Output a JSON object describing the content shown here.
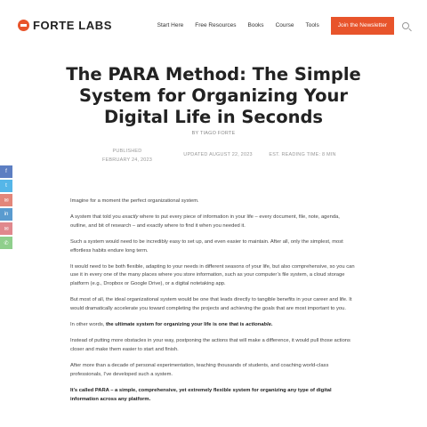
{
  "brand": {
    "name": "FORTE LABS",
    "accent_color": "#e8542b"
  },
  "nav": {
    "items": [
      "Start Here",
      "Free Resources",
      "Books",
      "Course",
      "Tools"
    ],
    "cta_label": "Join the Newsletter",
    "search_icon": "search-icon"
  },
  "article": {
    "title": "The PARA Method: The Simple System for Organizing Your Digital Life in Seconds",
    "byline": "BY TIAGO FORTE",
    "published_label": "PUBLISHED",
    "published_date": "FEBRUARY 24, 2023",
    "updated": "UPDATED AUGUST 22, 2023",
    "reading_time": "EST. READING TIME: 8 MIN",
    "p1": "Imagine for a moment the perfect organizational system.",
    "p2_before": "A system that told you ",
    "p2_em": "exactly",
    "p2_after": " where to put every piece of information in your life – every document, file, note, agenda, outline, and bit of research – and exactly where to find it when you needed it.",
    "p3": "Such a system would need to be incredibly easy to set up, and even easier to maintain. After all, only the simplest, most effortless habits endure long term.",
    "p4": "It would need to be both flexible, adapting to your needs in different seasons of your life, but also comprehensive, so you can use it in every one of the many places where you store information, such as your computer’s file system, a cloud storage platform (e.g., Dropbox or Google Drive), or a digital notetaking app.",
    "p5": "But most of all, the ideal organizational system would be one that leads directly to tangible benefits in your career and life. It would dramatically accelerate you toward completing the projects and achieving the goals that are most important to you.",
    "p6_before": "In other words, ",
    "p6_strong": "the ultimate system for organizing your life is one that is ",
    "p6_strong_em": "actionable",
    "p6_end": ".",
    "p7": "Instead of putting more obstacles in your way, postponing the actions that will make a difference, it would pull those actions closer and make them easier to start and finish.",
    "p8": "After more than a decade of personal experimentation, teaching thousands of students, and coaching world-class professionals, I’ve developed such a system.",
    "p9": "It’s called PARA – a simple, comprehensive, yet extremely flexible system for organizing any type of digital information across any platform."
  },
  "share_buttons": [
    {
      "icon": "facebook-icon",
      "glyph": "f",
      "color": "#5c7ec2"
    },
    {
      "icon": "twitter-icon",
      "glyph": "t",
      "color": "#55b6e8"
    },
    {
      "icon": "email-icon",
      "glyph": "✉",
      "color": "#e3867a"
    },
    {
      "icon": "linkedin-icon",
      "glyph": "in",
      "color": "#5a9bcf"
    },
    {
      "icon": "mail-icon",
      "glyph": "✉",
      "color": "#e0888d"
    },
    {
      "icon": "sms-icon",
      "glyph": "✆",
      "color": "#8fcf8c"
    }
  ]
}
